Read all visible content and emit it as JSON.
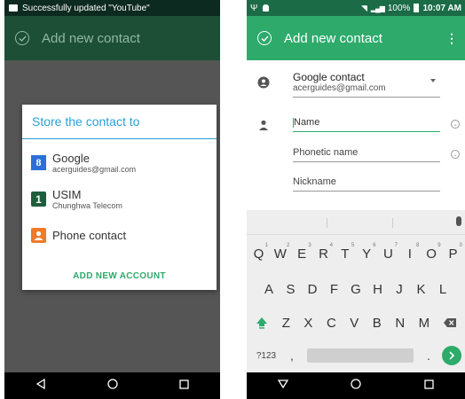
{
  "left": {
    "notification": "Successfully updated \"YouTube\"",
    "appbar_title": "Add new contact",
    "dialog": {
      "title": "Store the contact to",
      "accounts": [
        {
          "name": "Google",
          "sub": "acerguides@gmail.com",
          "icon": "google-icon"
        },
        {
          "name": "USIM",
          "sub": "Chunghwa Telecom",
          "icon": "sim-icon"
        },
        {
          "name": "Phone contact",
          "sub": "",
          "icon": "phone-contact-icon"
        }
      ],
      "add_account_label": "ADD NEW ACCOUNT"
    }
  },
  "right": {
    "status": {
      "battery": "100%",
      "time": "10:07 AM"
    },
    "appbar_title": "Add new contact",
    "account": {
      "name": "Google contact",
      "email": "acerguides@gmail.com"
    },
    "fields": {
      "name_placeholder": "Name",
      "phonetic_placeholder": "Phonetic name",
      "nickname_placeholder": "Nickname"
    },
    "keyboard": {
      "row1": [
        "Q",
        "W",
        "E",
        "R",
        "T",
        "Y",
        "U",
        "I",
        "O",
        "P"
      ],
      "row1_hints": [
        "1",
        "2",
        "3",
        "4",
        "5",
        "6",
        "7",
        "8",
        "9",
        "0"
      ],
      "row2": [
        "A",
        "S",
        "D",
        "F",
        "G",
        "H",
        "J",
        "K",
        "L"
      ],
      "row3": [
        "Z",
        "X",
        "C",
        "V",
        "B",
        "N",
        "M"
      ],
      "symbols_key": "?123",
      "comma_key": ",",
      "period_key": "."
    }
  },
  "colors": {
    "accent_green": "#2eaa6b",
    "dialog_blue": "#2aa0d7"
  }
}
